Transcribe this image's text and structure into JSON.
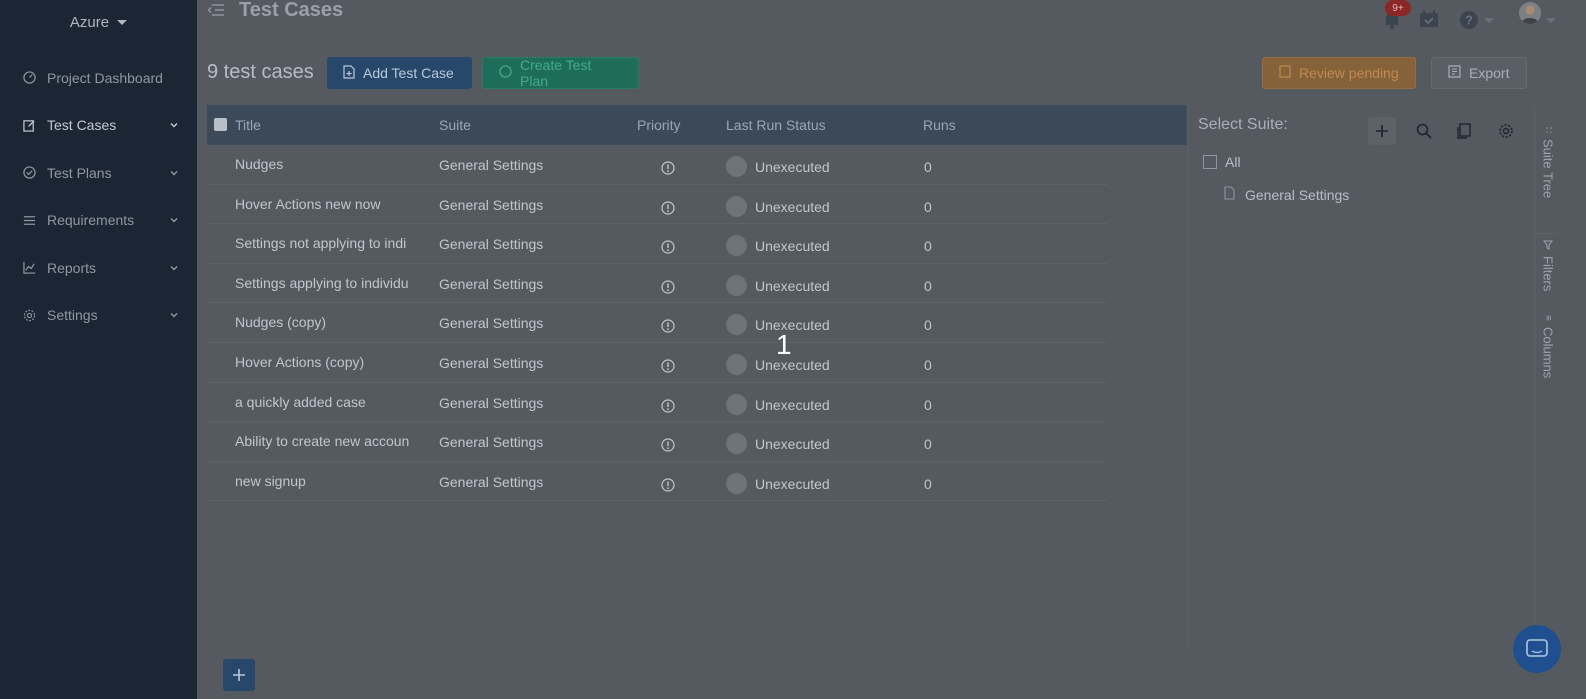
{
  "sidebar": {
    "project": "Azure",
    "items": [
      {
        "label": "Project Dashboard",
        "icon": "dashboard-icon",
        "has_children": false
      },
      {
        "label": "Test Cases",
        "icon": "edit-icon",
        "has_children": true,
        "active": true
      },
      {
        "label": "Test Plans",
        "icon": "check-circle-icon",
        "has_children": true
      },
      {
        "label": "Requirements",
        "icon": "list-icon",
        "has_children": true
      },
      {
        "label": "Reports",
        "icon": "chart-icon",
        "has_children": true
      },
      {
        "label": "Settings",
        "icon": "gear-icon",
        "has_children": true
      }
    ]
  },
  "header": {
    "title": "Test Cases",
    "notifications_badge": "9+"
  },
  "toolbar": {
    "count": "9 test cases",
    "add_label": "Add Test Case",
    "plan_label": "Create Test Plan",
    "review_label": "Review pending",
    "export_label": "Export"
  },
  "table": {
    "columns": [
      "Title",
      "Suite",
      "Priority",
      "Last Run Status",
      "Runs"
    ],
    "rows": [
      {
        "title": "Nudges",
        "suite": "General Settings",
        "status": "Unexecuted",
        "runs": "0"
      },
      {
        "title": "Hover Actions new now",
        "suite": "General Settings",
        "status": "Unexecuted",
        "runs": "0"
      },
      {
        "title": "Settings not applying to indi",
        "suite": "General Settings",
        "status": "Unexecuted",
        "runs": "0"
      },
      {
        "title": "Settings applying to individu",
        "suite": "General Settings",
        "status": "Unexecuted",
        "runs": "0"
      },
      {
        "title": "Nudges (copy)",
        "suite": "General Settings",
        "status": "Unexecuted",
        "runs": "0"
      },
      {
        "title": "Hover Actions (copy)",
        "suite": "General Settings",
        "status": "Unexecuted",
        "runs": "0"
      },
      {
        "title": "a quickly added case",
        "suite": "General Settings",
        "status": "Unexecuted",
        "runs": "0"
      },
      {
        "title": "Ability to create new accoun",
        "suite": "General Settings",
        "status": "Unexecuted",
        "runs": "0"
      },
      {
        "title": "new signup",
        "suite": "General Settings",
        "status": "Unexecuted",
        "runs": "0"
      }
    ]
  },
  "overlay": {
    "step_number": "1"
  },
  "suite_panel": {
    "title": "Select Suite:",
    "tree": {
      "root": "All",
      "children": [
        "General Settings"
      ]
    }
  },
  "side_tabs": [
    "Suite Tree",
    "Filters",
    "Columns"
  ],
  "colors": {
    "sidebar_bg": "#1c2534",
    "primary": "#27476b",
    "success": "#1e6d5b",
    "warning": "#85623a",
    "badge": "#8a2828"
  }
}
